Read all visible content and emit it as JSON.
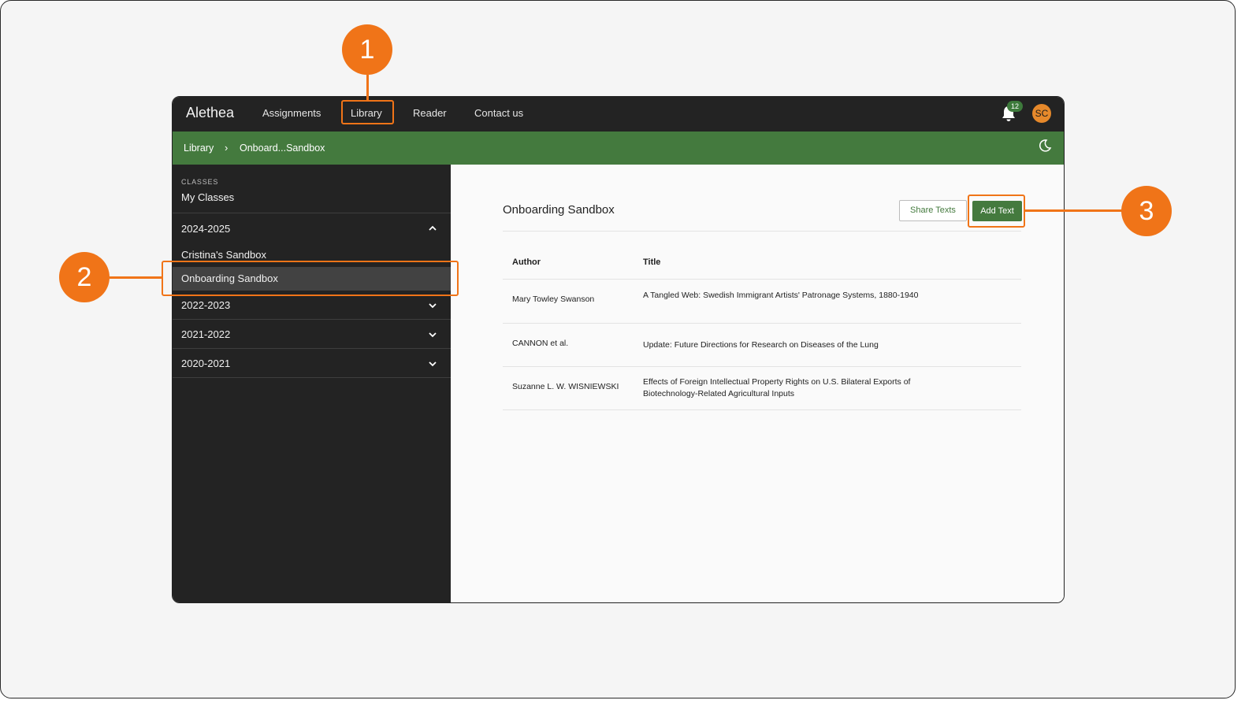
{
  "app": {
    "brand": "Alethea",
    "nav": [
      {
        "label": "Assignments"
      },
      {
        "label": "Library"
      },
      {
        "label": "Reader"
      },
      {
        "label": "Contact us"
      }
    ],
    "notifications_count": "12",
    "avatar_initials": "SC"
  },
  "breadcrumb": {
    "root": "Library",
    "separator": "›",
    "current": "Onboard...Sandbox"
  },
  "sidebar": {
    "section_label": "CLASSES",
    "my_classes": "My Classes",
    "years": [
      {
        "label": "2024-2025",
        "expanded": true,
        "classes": [
          "Cristina's Sandbox",
          "Onboarding Sandbox"
        ]
      },
      {
        "label": "2022-2023",
        "expanded": false
      },
      {
        "label": "2021-2022",
        "expanded": false
      },
      {
        "label": "2020-2021",
        "expanded": false
      }
    ],
    "selected_class": "Onboarding Sandbox"
  },
  "main": {
    "title": "Onboarding Sandbox",
    "share_label": "Share Texts",
    "add_label": "Add Text",
    "table": {
      "headers": [
        "Author",
        "Title"
      ],
      "rows": [
        {
          "author": "Mary Towley Swanson",
          "title": "A Tangled Web: Swedish Immigrant Artists' Patronage Systems, 1880-1940"
        },
        {
          "author": "CANNON et al.",
          "title": "Update: Future Directions for Research on Diseases of the Lung"
        },
        {
          "author": "Suzanne L. W. WISNIEWSKI",
          "title": "Effects of Foreign Intellectual Property Rights on U.S. Bilateral Exports of Biotechnology-Related Agricultural Inputs"
        }
      ]
    }
  },
  "callouts": [
    "1",
    "2",
    "3"
  ],
  "colors": {
    "accent_green": "#447a3e",
    "callout_orange": "#f07418",
    "topbar": "#232323"
  }
}
